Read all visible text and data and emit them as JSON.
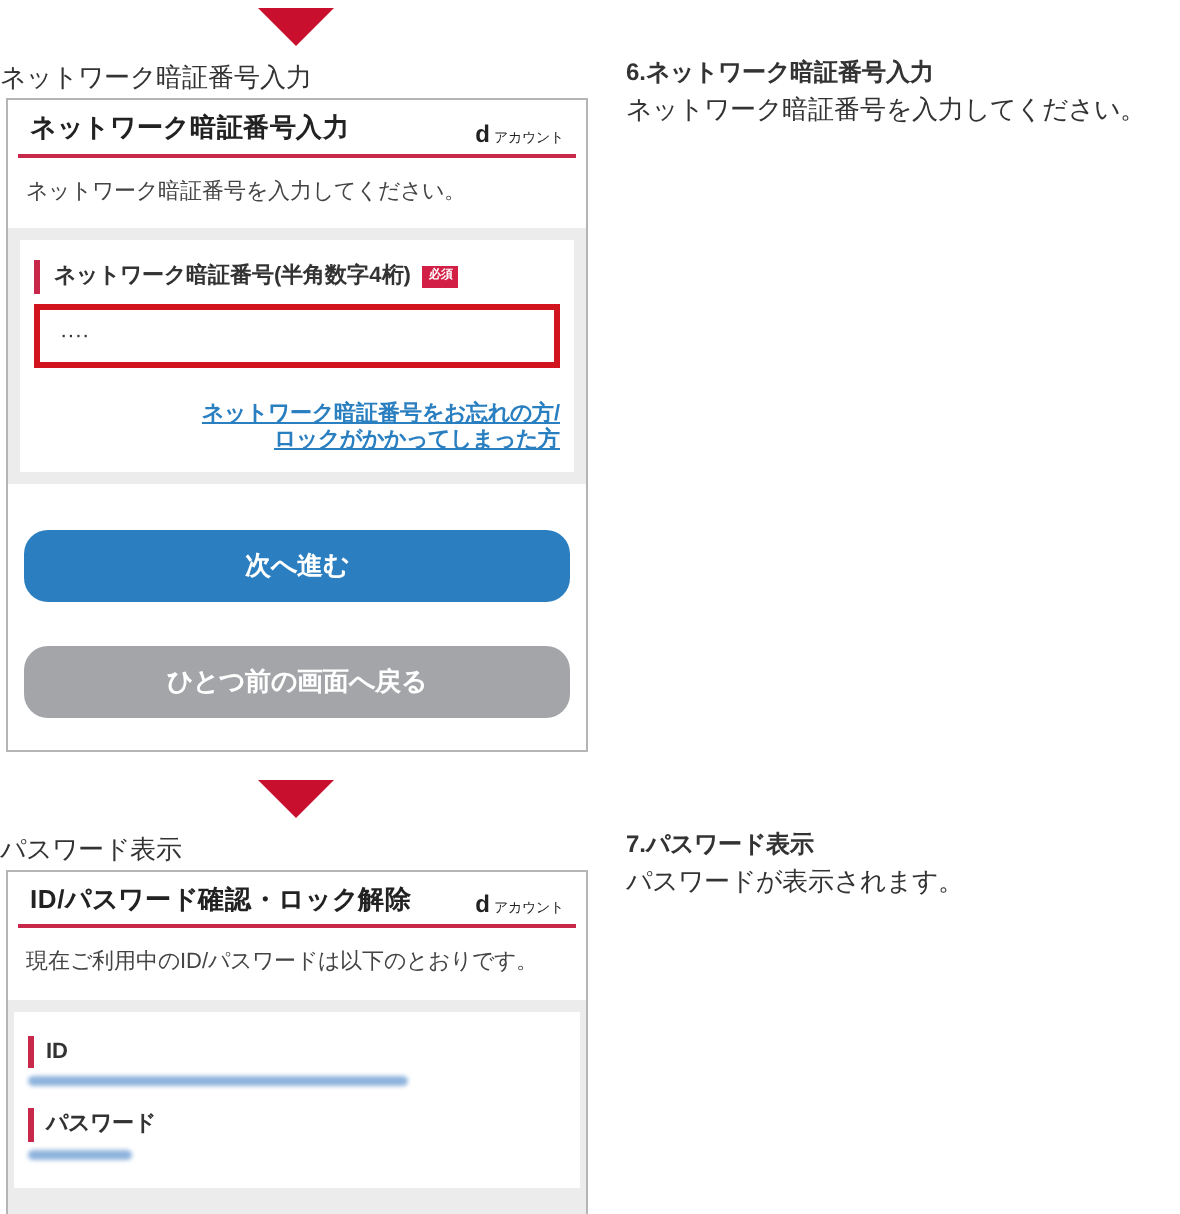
{
  "steps": [
    {
      "kind": "pin_entry",
      "caption": "ネットワーク暗証番号入力",
      "heading": "6.ネットワーク暗証番号入力",
      "description": "ネットワーク暗証番号を入力してください。",
      "screen": {
        "title": "ネットワーク暗証番号入力",
        "brand": {
          "mark": "d",
          "text": "アカウント"
        },
        "intro": "ネットワーク暗証番号を入力してください。",
        "field": {
          "label": "ネットワーク暗証番号(半角数字4桁)",
          "badge": "必須",
          "value": "····",
          "highlighted": true
        },
        "link": "ネットワーク暗証番号をお忘れの方/\nロックがかかってしまった方",
        "buttons": [
          {
            "label": "次へ進む",
            "kind": "primary"
          },
          {
            "label": "ひとつ前の画面へ戻る",
            "kind": "secondary"
          }
        ]
      }
    },
    {
      "kind": "password_display",
      "caption": "パスワード表示",
      "heading": "7.パスワード表示",
      "description": "パスワードが表示されます。",
      "screen": {
        "title": "ID/パスワード確認・ロック解除",
        "brand": {
          "mark": "d",
          "text": "アカウント"
        },
        "intro": "現在ご利用中のID/パスワードは以下のとおりです。",
        "items": [
          {
            "label": "ID",
            "kind": "long"
          },
          {
            "label": "パスワード",
            "kind": "short"
          }
        ]
      }
    }
  ]
}
